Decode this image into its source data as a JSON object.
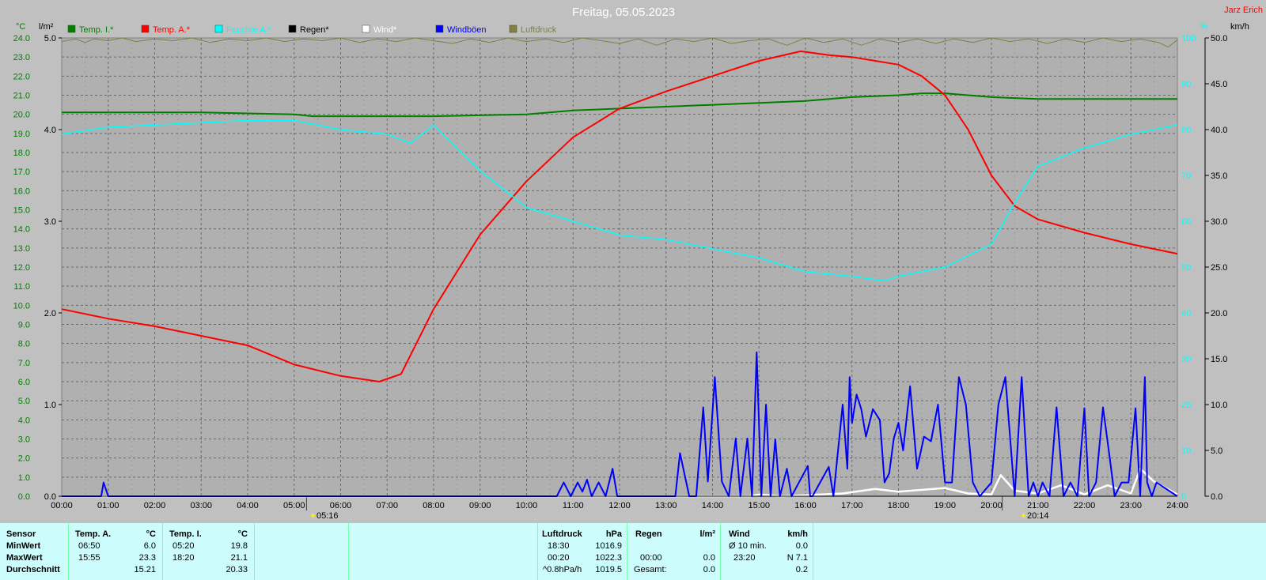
{
  "header": {
    "date_title": "Freitag, 05.05.2023",
    "brand": "Jarz Erich"
  },
  "legend": [
    {
      "label": "Temp. I.*",
      "color": "#007f00"
    },
    {
      "label": "Temp. A.*",
      "color": "#ff0000"
    },
    {
      "label": "Feuchte A.*",
      "color": "#00ffff"
    },
    {
      "label": "Regen*",
      "color": "#000000"
    },
    {
      "label": "Wind*",
      "color": "#ffffff"
    },
    {
      "label": "Windböen",
      "color": "#0000ff"
    },
    {
      "label": "Luftdruck",
      "color": "#808040"
    }
  ],
  "axis_units": {
    "temp": "°C",
    "rain": "l/m²",
    "humidity": "%",
    "wind": "km/h"
  },
  "markers": [
    "05:16",
    "20:14"
  ],
  "chart_data": {
    "type": "line",
    "xlim": [
      "00:00",
      "24:00"
    ],
    "x_ticks": [
      "00:00",
      "01:00",
      "02:00",
      "03:00",
      "04:00",
      "05:00",
      "06:00",
      "07:00",
      "08:00",
      "09:00",
      "10:00",
      "11:00",
      "12:00",
      "13:00",
      "14:00",
      "15:00",
      "16:00",
      "17:00",
      "18:00",
      "19:00",
      "20:00",
      "21:00",
      "22:00",
      "23:00",
      "24:00"
    ],
    "axes": {
      "temp": {
        "unit": "°C",
        "ylim": [
          0,
          24
        ],
        "ticks": [
          "0.0",
          "1.0",
          "2.0",
          "3.0",
          "4.0",
          "5.0",
          "6.0",
          "7.0",
          "8.0",
          "9.0",
          "10.0",
          "11.0",
          "12.0",
          "13.0",
          "14.0",
          "15.0",
          "16.0",
          "17.0",
          "18.0",
          "19.0",
          "20.0",
          "21.0",
          "22.0",
          "23.0",
          "24.0"
        ]
      },
      "rain": {
        "unit": "l/m²",
        "ylim": [
          0,
          5
        ],
        "ticks": [
          "0.0",
          "1.0",
          "2.0",
          "3.0",
          "4.0",
          "5.0"
        ]
      },
      "humidity": {
        "unit": "%",
        "ylim": [
          0,
          100
        ],
        "ticks": [
          "0",
          "10",
          "20",
          "30",
          "40",
          "50",
          "60",
          "70",
          "80",
          "90",
          "100"
        ]
      },
      "wind": {
        "unit": "km/h",
        "ylim": [
          0,
          50
        ],
        "ticks": [
          "0.0",
          "5.0",
          "10.0",
          "15.0",
          "20.0",
          "25.0",
          "30.0",
          "35.0",
          "40.0",
          "45.0",
          "50.0"
        ]
      }
    },
    "series": [
      {
        "name": "Temp. I.*",
        "axis": "temp",
        "color": "#007f00",
        "x": [
          0,
          3,
          5,
          5.4,
          8,
          10,
          11,
          12,
          13,
          14,
          15,
          16,
          17,
          18,
          18.5,
          19,
          20,
          21,
          24
        ],
        "y": [
          20.1,
          20.1,
          20.0,
          19.9,
          19.9,
          20.0,
          20.2,
          20.3,
          20.4,
          20.5,
          20.6,
          20.7,
          20.9,
          21.0,
          21.1,
          21.1,
          20.9,
          20.8,
          20.8
        ]
      },
      {
        "name": "Temp. A.*",
        "axis": "temp",
        "color": "#ff0000",
        "x": [
          0,
          1,
          2,
          3,
          4,
          5,
          6,
          6.83,
          7.3,
          8,
          9,
          10,
          11,
          12,
          13,
          14,
          15,
          15.9,
          16.5,
          17,
          17.5,
          18,
          18.5,
          19,
          19.5,
          20,
          20.5,
          21,
          22,
          23,
          24
        ],
        "y": [
          9.8,
          9.3,
          8.9,
          8.4,
          7.9,
          6.9,
          6.3,
          6.0,
          6.4,
          9.8,
          13.7,
          16.5,
          18.8,
          20.3,
          21.2,
          22.0,
          22.8,
          23.3,
          23.1,
          23.0,
          22.8,
          22.6,
          22.0,
          21.0,
          19.2,
          16.8,
          15.2,
          14.5,
          13.8,
          13.2,
          12.7
        ]
      },
      {
        "name": "Feuchte A.*",
        "axis": "humidity",
        "color": "#00ffff",
        "x": [
          0,
          1,
          2,
          3,
          4,
          5,
          6,
          7,
          7.5,
          8,
          9,
          10,
          11,
          12,
          13,
          14,
          15,
          16,
          17,
          17.7,
          18,
          19,
          20,
          20.5,
          21,
          22,
          23,
          24
        ],
        "y": [
          79,
          80.5,
          81,
          81.5,
          82,
          82,
          80,
          79,
          77,
          81,
          71,
          63,
          60,
          57,
          56,
          54,
          52,
          49,
          48,
          47,
          48,
          50,
          55,
          64,
          72,
          76,
          79,
          81
        ]
      },
      {
        "name": "Wind*",
        "axis": "wind",
        "color": "#ffffff",
        "x": [
          0,
          14.8,
          15.0,
          15.5,
          16.8,
          17.5,
          18.0,
          19.0,
          19.5,
          20.0,
          20.2,
          20.5,
          21.0,
          21.5,
          22.0,
          22.5,
          23.0,
          23.2,
          23.5,
          24.0
        ],
        "y": [
          0,
          0,
          0.2,
          0,
          0.3,
          0.8,
          0.5,
          0.9,
          0.3,
          0.2,
          2.3,
          0.6,
          0.3,
          1.2,
          0.2,
          1.2,
          0.3,
          3.0,
          1.6,
          0.2
        ]
      },
      {
        "name": "Windböen",
        "axis": "wind",
        "color": "#0000ff",
        "x": [
          0,
          0.85,
          0.9,
          1.0,
          10.65,
          10.8,
          10.95,
          11.1,
          11.2,
          11.3,
          11.4,
          11.55,
          11.7,
          11.85,
          11.95,
          13.2,
          13.3,
          13.5,
          13.65,
          13.8,
          13.9,
          14.05,
          14.2,
          14.35,
          14.5,
          14.6,
          14.75,
          14.85,
          14.95,
          15.05,
          15.15,
          15.25,
          15.35,
          15.45,
          15.6,
          15.7,
          16.05,
          16.1,
          16.15,
          16.5,
          16.6,
          16.8,
          16.9,
          16.95,
          17.0,
          17.1,
          17.2,
          17.3,
          17.45,
          17.6,
          17.7,
          17.8,
          17.9,
          18.0,
          18.1,
          18.25,
          18.4,
          18.55,
          18.7,
          18.85,
          19.0,
          19.15,
          19.3,
          19.45,
          19.6,
          19.75,
          20.0,
          20.15,
          20.3,
          20.5,
          20.65,
          20.8,
          20.9,
          21.0,
          21.1,
          21.25,
          21.4,
          21.55,
          21.7,
          21.85,
          22.0,
          22.1,
          22.25,
          22.4,
          22.55,
          22.65,
          22.8,
          22.95,
          23.1,
          23.2,
          23.3,
          23.35,
          23.45,
          23.55,
          24.0
        ],
        "y": [
          0,
          0,
          1.5,
          0,
          0,
          1.5,
          0,
          1.5,
          0.5,
          1.8,
          0,
          1.5,
          0,
          3.0,
          0,
          0,
          4.7,
          0,
          0,
          9.7,
          1.6,
          13.0,
          1.6,
          0,
          6.3,
          0,
          6.3,
          0,
          15.7,
          0,
          10.0,
          0,
          6.2,
          0,
          3.0,
          0,
          3.3,
          0,
          0,
          3.2,
          0,
          10.0,
          3.0,
          13.0,
          8.0,
          11.1,
          9.5,
          6.5,
          9.5,
          8.3,
          1.5,
          2.5,
          6.3,
          8.0,
          5.0,
          12.0,
          3.0,
          6.5,
          6.0,
          10.0,
          1.5,
          1.5,
          13.0,
          10.0,
          1.5,
          0,
          1.5,
          10.0,
          13.0,
          0,
          13.0,
          0,
          1.5,
          0,
          1.5,
          0,
          9.7,
          0,
          1.5,
          0,
          9.6,
          0,
          1.5,
          9.7,
          4.0,
          0,
          1.5,
          1.5,
          9.6,
          0,
          13.0,
          1.5,
          0,
          1.5,
          0
        ]
      },
      {
        "name": "Luftdruck",
        "axis": "rain",
        "color": "#808040",
        "x": [
          0,
          0.3,
          0.5,
          0.7,
          1.0,
          1.3,
          1.6,
          2.0,
          2.4,
          2.8,
          3.2,
          3.6,
          4.0,
          4.4,
          4.8,
          5.2,
          5.6,
          6.0,
          6.4,
          6.8,
          7.2,
          7.6,
          8.0,
          8.4,
          8.8,
          9.2,
          9.6,
          10.0,
          10.4,
          10.8,
          11.2,
          11.6,
          12.0,
          12.4,
          12.8,
          13.2,
          13.6,
          14.0,
          14.4,
          14.8,
          15.2,
          15.6,
          16.0,
          16.4,
          16.8,
          17.2,
          17.6,
          18.0,
          18.4,
          18.8,
          19.2,
          19.6,
          20.0,
          20.4,
          20.8,
          21.2,
          21.6,
          22.0,
          22.4,
          22.8,
          23.2,
          23.6,
          23.8,
          24.0
        ],
        "y": [
          4.96,
          4.99,
          4.95,
          4.99,
          4.97,
          5.0,
          4.96,
          4.99,
          4.97,
          5.0,
          4.95,
          4.99,
          4.97,
          5.0,
          4.96,
          4.99,
          4.97,
          5.0,
          4.95,
          4.99,
          4.96,
          5.0,
          4.97,
          4.94,
          4.99,
          4.95,
          5.0,
          4.96,
          4.99,
          4.95,
          5.0,
          4.97,
          4.94,
          4.99,
          4.92,
          4.99,
          4.96,
          5.0,
          4.94,
          4.97,
          4.99,
          4.92,
          5.0,
          4.95,
          4.99,
          4.92,
          4.99,
          4.95,
          4.99,
          4.94,
          4.99,
          4.95,
          5.0,
          4.96,
          4.99,
          4.94,
          4.99,
          4.95,
          5.0,
          4.96,
          4.99,
          4.95,
          4.9,
          4.98
        ]
      },
      {
        "name": "Regen*",
        "axis": "rain",
        "color": "#000000",
        "x": [
          0,
          24
        ],
        "y": [
          0,
          0
        ]
      }
    ]
  },
  "stats": {
    "row_labels": [
      "Sensor",
      "MinWert",
      "MaxWert",
      "Durchschnitt"
    ],
    "temp_a": {
      "title": "Temp. A.",
      "unit": "°C",
      "min_time": "06:50",
      "min": "6.0",
      "max_time": "15:55",
      "max": "23.3",
      "avg": "15.21"
    },
    "temp_i": {
      "title": "Temp. I.",
      "unit": "°C",
      "min_time": "05:20",
      "min": "19.8",
      "max_time": "18:20",
      "max": "21.1",
      "avg": "20.33"
    },
    "pressure": {
      "title": "Luftdruck",
      "unit": "hPa",
      "min_time": "18:30",
      "min": "1016.9",
      "max_time": "00:20",
      "max": "1022.3",
      "trend": "^0.8hPa/h",
      "avg": "1019.5"
    },
    "rain": {
      "title": "Regen",
      "unit": "l/m²",
      "max_time": "00:00",
      "max": "0.0",
      "total_label": "Gesamt:",
      "total": "0.0"
    },
    "wind": {
      "title": "Wind",
      "unit": "km/h",
      "min_label": "Ø 10 min.",
      "min": "0.0",
      "max_time": "23:20",
      "max": "N 7.1",
      "avg": "0.2"
    }
  }
}
